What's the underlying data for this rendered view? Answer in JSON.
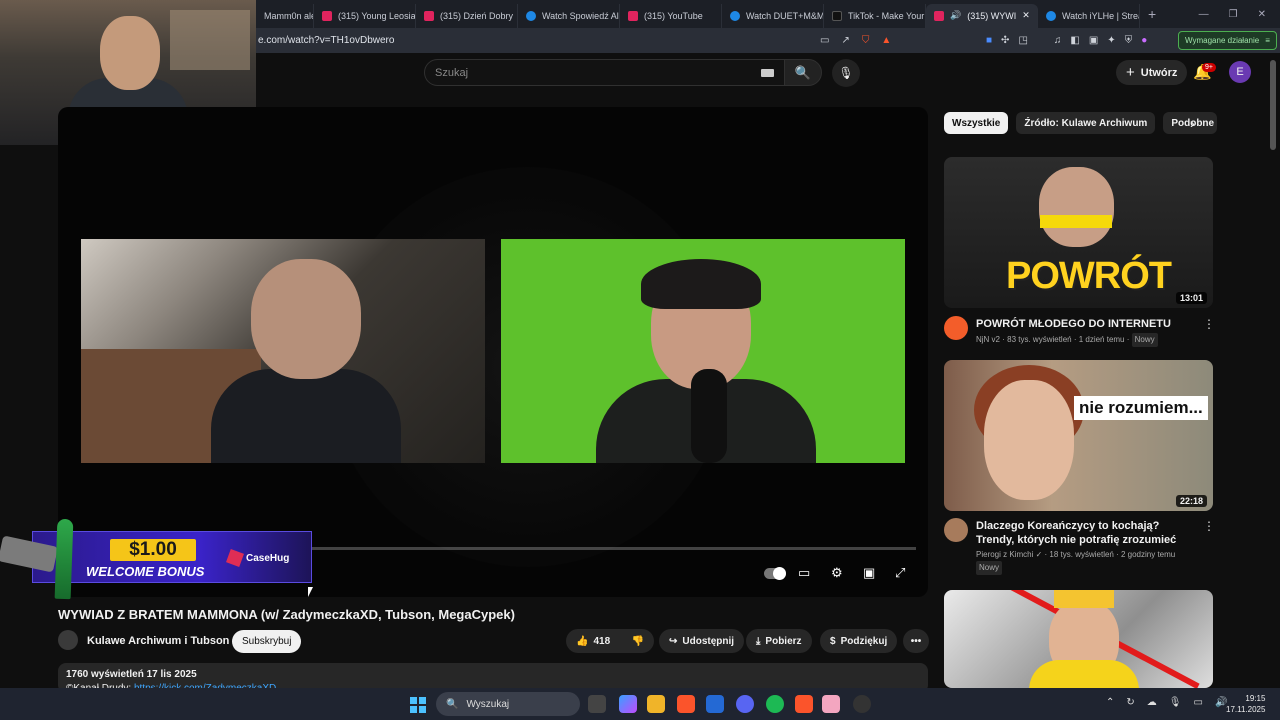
{
  "browser": {
    "tabs": [
      {
        "label": "Mamm0n ale",
        "icon": "youtube-icon"
      },
      {
        "label": "(315) Young Leosia",
        "icon": "youtube-icon"
      },
      {
        "label": "(315) Dzień Dobry",
        "icon": "youtube-icon"
      },
      {
        "label": "Watch Spowiedź Al",
        "icon": "watch-icon"
      },
      {
        "label": "(315) YouTube",
        "icon": "youtube-icon"
      },
      {
        "label": "Watch DUET+M&M",
        "icon": "watch-icon"
      },
      {
        "label": "TikTok - Make Your",
        "icon": "tiktok-icon"
      },
      {
        "label": "(315) WYWI",
        "icon": "youtube-icon",
        "active": true
      },
      {
        "label": "Watch iYLHe | Strea",
        "icon": "watch-icon"
      }
    ],
    "new_tab": "+",
    "url": "e.com/watch?v=TH1ovDbwero",
    "extension_action": "Wymagane działanie",
    "menu_icon": "≡"
  },
  "youtube": {
    "search_placeholder": "Szukaj",
    "create_label": "Utwórz",
    "notification_count": "9+",
    "avatar_letter": "E"
  },
  "ad": {
    "price": "$1.00",
    "bonus": "WELCOME BONUS",
    "brand": "CaseHug"
  },
  "video": {
    "title": "WYWIAD Z BRATEM MAMMONA (w/ ZadymeczkaXD, Tubson, MegaCypek)",
    "channel": "Kulawe Archiwum i Tubson",
    "subscribe": "Subskrybuj",
    "likes": "418",
    "share": "Udostępnij",
    "download": "Pobierz",
    "thanks": "Podziękuj",
    "views_date": "1760 wyświetleń  17 lis 2025",
    "desc_line": "©Kanał Drudy: ",
    "desc_link": "https://kick.com/ZadymeczkaXD"
  },
  "sidebar": {
    "chips": [
      "Wszystkie",
      "Źródło: Kulawe Archiwum",
      "Podobne"
    ],
    "recs": [
      {
        "thumb_text": "POWRÓT",
        "duration": "13:01",
        "title": "POWRÓT MŁODEGO DO INTERNETU",
        "channel": "NjN v2",
        "meta": "83 tys. wyświetleń · 1 dzień temu",
        "badge": "Nowy"
      },
      {
        "thumb_text": "nie rozumiem...",
        "duration": "22:18",
        "title": "Dlaczego Koreańczycy to kochają? Trendy, których nie potrafię zrozumieć",
        "channel": "Pierogi z Kimchi",
        "meta": "18 tys. wyświetleń · 2 godziny temu",
        "badge": "Nowy"
      }
    ]
  },
  "taskbar": {
    "search": "Wyszukaj",
    "time": "19:15",
    "date": "17.11.2025"
  }
}
